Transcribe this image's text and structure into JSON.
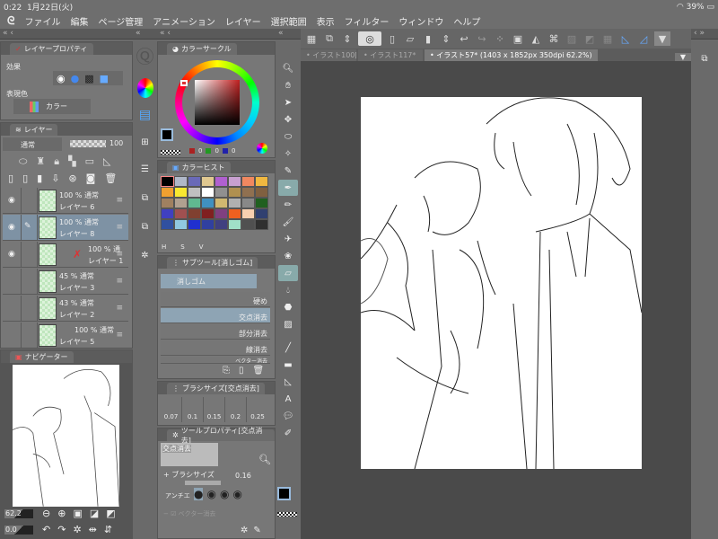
{
  "status": {
    "time": "0:22",
    "date": "1月22日(火)",
    "battery": "39%"
  },
  "menu": [
    "ファイル",
    "編集",
    "ページ管理",
    "アニメーション",
    "レイヤー",
    "選択範囲",
    "表示",
    "フィルター",
    "ウィンドウ",
    "ヘルプ"
  ],
  "layer_property": {
    "title": "レイヤープロパティ",
    "effect_label": "効果",
    "color_label": "表現色",
    "color_value": "カラー"
  },
  "layers": {
    "title": "レイヤー",
    "blend": "通常",
    "opacity": "100",
    "items": [
      {
        "opacity": "100 % 通常",
        "name": "レイヤー 6",
        "visible": true
      },
      {
        "opacity": "100 % 通常",
        "name": "レイヤー 8",
        "visible": true,
        "selected": true
      },
      {
        "opacity": "100 % 通",
        "name": "レイヤー 1",
        "visible": true
      },
      {
        "opacity": "45 % 通常",
        "name": "レイヤー 3",
        "visible": false
      },
      {
        "opacity": "43 % 通常",
        "name": "レイヤー 2",
        "visible": false
      },
      {
        "opacity": "100 % 通常",
        "name": "レイヤー 5",
        "visible": false
      }
    ]
  },
  "navigator": {
    "title": "ナビゲーター",
    "zoom": "62.2",
    "rotation": "0.0"
  },
  "color_circle": {
    "title": "カラーサークル",
    "r": "0",
    "g": "0",
    "b": "0",
    "accent": "#c03030"
  },
  "color_history": {
    "title": "カラーヒスト",
    "labels": [
      "H",
      "S",
      "V"
    ],
    "swatches": [
      "#000000",
      "#b0b8c8",
      "#6a6ab8",
      "#e0c890",
      "#b060d0",
      "#c8a0d0",
      "#f08860",
      "#f0b840",
      "#f0a030",
      "#f8e830",
      "#c0c0c0",
      "#ffffff",
      "#909090",
      "#b09050",
      "#907050",
      "#806040",
      "#a08060",
      "#b0a090",
      "#60b890",
      "#4090c0",
      "#d0b870",
      "#b0b0b0",
      "#888888",
      "#206020",
      "#4040c0",
      "#a05050",
      "#804030",
      "#802020",
      "#804080",
      "#f06020",
      "#f8d0b0",
      "#304070",
      "#3050a0",
      "#90c8e0",
      "#2030d0",
      "#3040a0",
      "#404080",
      "#a0e0c8",
      "#505050",
      "#303030"
    ]
  },
  "subtool": {
    "title": "サブツール[消しゴム]",
    "group": "消しゴム",
    "items": [
      "硬め",
      "交点消去",
      "部分消去",
      "線消去",
      "ベクター消去"
    ]
  },
  "brush_size": {
    "title": "ブラシサイズ[交点消去]",
    "sizes": [
      "0.07",
      "0.1",
      "0.15",
      "0.2",
      "0.25"
    ]
  },
  "tool_property": {
    "title": "ツールプロパティ[交点消去]",
    "preview_label": "交点消去",
    "brush_size_label": "ブラシサイズ",
    "brush_size_value": "0.16",
    "antialias_label": "アンチエ",
    "vector_erase_label": "ベクター消去"
  },
  "canvas_tabs": [
    "イラスト100[!",
    "イラスト117*",
    "イラスト57* (1403 x 1852px 350dpi 62.2%)"
  ]
}
